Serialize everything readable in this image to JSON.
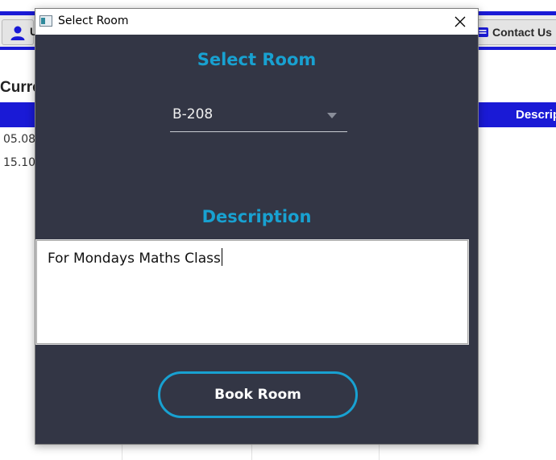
{
  "background": {
    "user_button_peek": "U",
    "contact_button_label": "Contact Us",
    "section_title_peek": "Curre",
    "table_header_peek": "Descrip",
    "rows": [
      {
        "date_peek": "05.08.."
      },
      {
        "date_peek": "15.10.."
      }
    ]
  },
  "dialog": {
    "title": "Select Room",
    "close_glyph": "✕",
    "room_heading": "Select Room",
    "room_selected": "B-208",
    "description_heading": "Description",
    "description_value": "For Mondays Maths Class",
    "book_button_label": "Book Room"
  },
  "colors": {
    "accent": "#18a1d1",
    "dialog_bg": "#333645",
    "app_blue": "#1a1ad6"
  }
}
